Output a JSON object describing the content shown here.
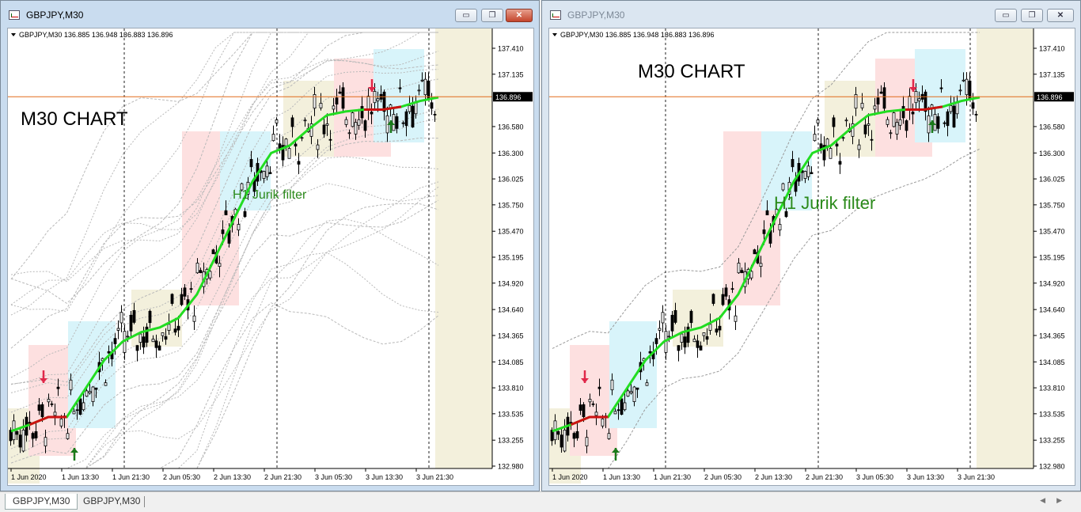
{
  "windows": [
    {
      "title": "GBPJPY,M30",
      "active": true,
      "info": "GBPJPY,M30  136.885 136.948 136.883 136.896",
      "label": "M30  CHART",
      "jurik": "H1  Jurik filter",
      "price_tag": "136.896"
    },
    {
      "title": "GBPJPY,M30",
      "active": false,
      "info": "GBPJPY,M30  136.885 136.948 136.883 136.896",
      "label": "M30  CHART",
      "jurik": "H1  Jurik filter",
      "price_tag": "136.896"
    }
  ],
  "controls": {
    "minimize": "▭",
    "restore": "❐",
    "close": "✕"
  },
  "price_ticks": [
    "137.410",
    "137.135",
    "136.580",
    "136.300",
    "136.025",
    "135.750",
    "135.470",
    "135.195",
    "134.920",
    "134.640",
    "134.365",
    "134.085",
    "133.810",
    "133.535",
    "133.255",
    "132.980"
  ],
  "time_ticks": [
    "1 Jun 2020",
    "1 Jun 13:30",
    "1 Jun 21:30",
    "2 Jun 05:30",
    "2 Jun 13:30",
    "2 Jun 21:30",
    "3 Jun 05:30",
    "3 Jun 13:30",
    "3 Jun 21:30"
  ],
  "chart_data": {
    "type": "line",
    "symbol": "GBPJPY",
    "timeframe": "M30",
    "last_price": 136.896,
    "ohlc_last": {
      "open": 136.885,
      "high": 136.948,
      "low": 136.883,
      "close": 136.896
    },
    "ylim": [
      132.98,
      137.41
    ],
    "series": [
      {
        "name": "H1  Jurik filter",
        "color": "#22dd22",
        "values": [
          133.35,
          133.42,
          133.5,
          133.5,
          133.8,
          134.1,
          134.3,
          134.4,
          134.45,
          134.55,
          134.8,
          135.2,
          135.6,
          136.0,
          136.3,
          136.38,
          136.55,
          136.7,
          136.74,
          136.76,
          136.76,
          136.79,
          136.85,
          136.89
        ]
      }
    ],
    "colors": {
      "up_arrow": "#1a7a1a",
      "down_arrow": "#e0284a",
      "bid_line": "#e26b1a",
      "jurik_down": "#cc1111"
    }
  },
  "tabs": [
    {
      "label": "GBPJPY,M30",
      "selected": true
    },
    {
      "label": "GBPJPY,M30",
      "selected": false
    }
  ],
  "scroll": {
    "left": "◀",
    "right": "▶"
  }
}
